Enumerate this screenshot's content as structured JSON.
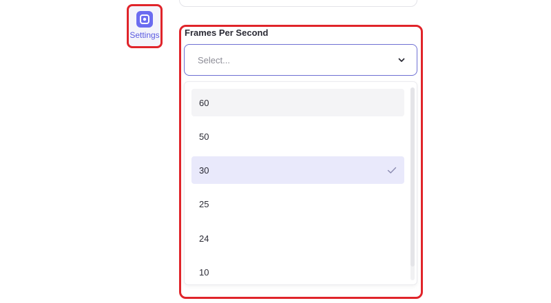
{
  "sidebar": {
    "settings_label": "Settings",
    "settings_icon": "settings-icon"
  },
  "fps_field": {
    "label": "Frames Per Second",
    "placeholder": "Select...",
    "chevron_icon": "chevron-down-icon",
    "options": [
      {
        "label": "60",
        "state": "hover"
      },
      {
        "label": "50",
        "state": "none"
      },
      {
        "label": "30",
        "state": "selected"
      },
      {
        "label": "25",
        "state": "none"
      },
      {
        "label": "24",
        "state": "none"
      },
      {
        "label": "10",
        "state": "none"
      }
    ],
    "selected_value": "30",
    "check_icon": "check-icon"
  },
  "colors": {
    "accent": "#6b6cf0",
    "highlight_outline": "#e0242a",
    "selected_row": "#e9e9fb",
    "hover_row": "#f4f4f6"
  }
}
